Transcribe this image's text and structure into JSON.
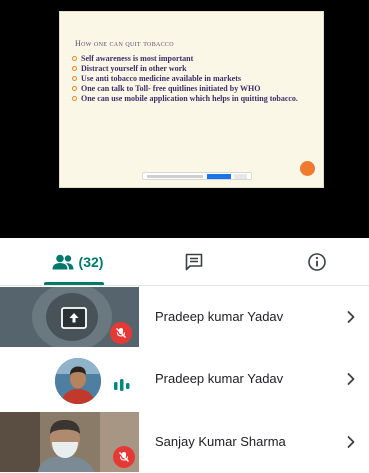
{
  "slide": {
    "title": "How one can quit tobacco",
    "bullets": [
      "Self awareness is most important",
      "Distract yourself in other work",
      "Use anti tobacco medicine available in markets",
      "One can talk to  Toll- free quitlines initiated by WHO",
      "One can use mobile application which helps in quitting  tobacco."
    ]
  },
  "tabs": {
    "people_count": "(32)",
    "chat_icon": "chat-icon",
    "info_icon": "info-icon"
  },
  "participants": [
    {
      "name": "Pradeep kumar Yadav",
      "state": "presenting, muted"
    },
    {
      "name": "Pradeep kumar Yadav",
      "state": "speaking"
    },
    {
      "name": "Sanjay Kumar Sharma",
      "state": "muted"
    }
  ],
  "colors": {
    "accent": "#00796b",
    "muted": "#e53935",
    "slide_bg": "#fbf7e6",
    "slide_text": "#3a2e6a",
    "bullet": "#e7862b"
  }
}
